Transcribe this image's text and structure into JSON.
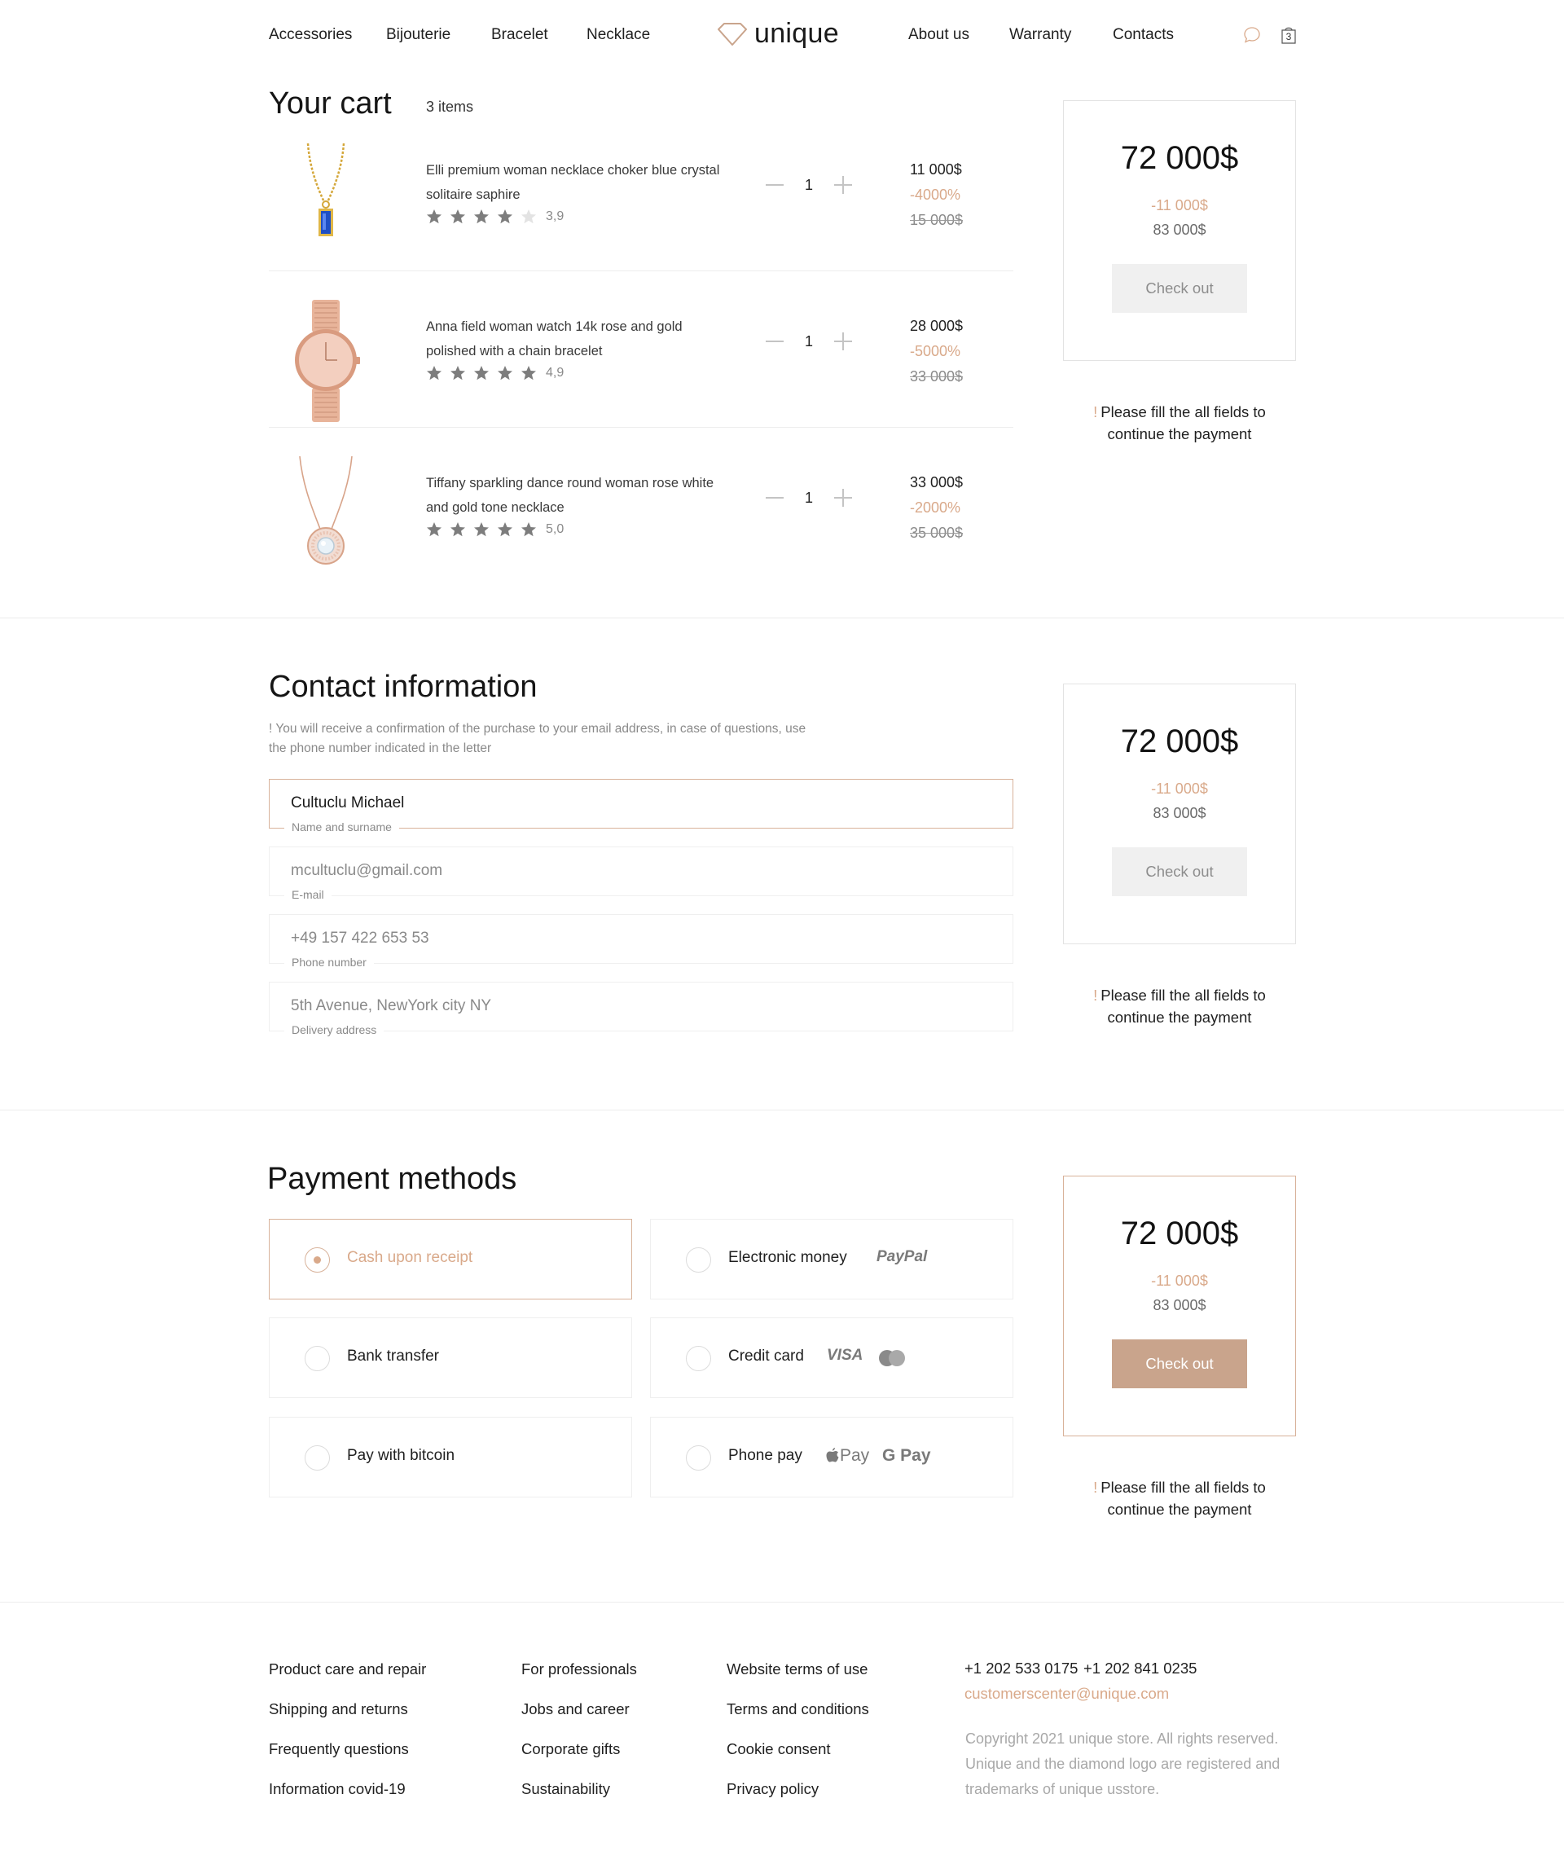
{
  "header": {
    "nav_left": [
      "Accessories",
      "Bijouterie",
      "Bracelet",
      "Necklace"
    ],
    "logo_text": "unique",
    "nav_right": [
      "About us",
      "Warranty",
      "Contacts"
    ],
    "cart_count": "3",
    "icons": [
      "chat-icon",
      "cart-bag-icon"
    ]
  },
  "cart": {
    "title": "Your cart",
    "count_label": "3 items",
    "items": [
      {
        "name": "Elli premium woman necklace choker blue crystal solitaire saphire",
        "rating": "3,9",
        "stars_filled": 4,
        "qty": "1",
        "price": "11 000$",
        "discount": "-4000%",
        "old_price": "15 000$",
        "image": "blue-pendant-necklace"
      },
      {
        "name": "Anna field woman watch 14k rose and gold polished with a chain bracelet",
        "rating": "4,9",
        "stars_filled": 5,
        "qty": "1",
        "price": "28 000$",
        "discount": "-5000%",
        "old_price": "33 000$",
        "image": "rose-gold-watch"
      },
      {
        "name": "Tiffany sparkling dance round woman rose white and gold tone necklace",
        "rating": "5,0",
        "stars_filled": 5,
        "qty": "1",
        "price": "33 000$",
        "discount": "-2000%",
        "old_price": "35 000$",
        "image": "round-diamond-necklace"
      }
    ]
  },
  "summary": {
    "total": "72 000$",
    "discount": "-11 000$",
    "original": "83 000$",
    "checkout_label": "Check out",
    "warning_mark": "!",
    "warning": "Please fill the all fields to continue the payment"
  },
  "contact": {
    "title": "Contact information",
    "note": "! You will receive a confirmation of the purchase to your email address, in case of questions, use the phone number indicated in the letter",
    "fields": [
      {
        "value": "Cultuclu Michael",
        "label": "Name and surname",
        "active": true
      },
      {
        "value": "mcultuclu@gmail.com",
        "label": "E-mail",
        "active": false
      },
      {
        "value": "+49 157 422 653 53",
        "label": "Phone number",
        "active": false
      },
      {
        "value": "5th Avenue, NewYork city NY",
        "label": "Delivery address",
        "active": false
      }
    ]
  },
  "payment": {
    "title": "Payment methods",
    "methods": [
      {
        "label": "Cash upon receipt",
        "selected": true
      },
      {
        "label": "Electronic money",
        "brand": "PayPal",
        "selected": false
      },
      {
        "label": "Bank transfer",
        "selected": false
      },
      {
        "label": "Credit card",
        "brand": "VISA",
        "selected": false
      },
      {
        "label": "Pay with bitcoin",
        "selected": false
      },
      {
        "label": "Phone pay",
        "brand_apple": "Pay",
        "brand_google": "G Pay",
        "selected": false
      }
    ]
  },
  "footer": {
    "col1": [
      "Product care and repair",
      "Shipping and returns",
      "Frequently questions",
      "Information covid-19"
    ],
    "col2": [
      "For professionals",
      "Jobs and career",
      "Corporate gifts",
      "Sustainability"
    ],
    "col3": [
      "Website terms of use",
      "Terms and conditions",
      "Cookie consent",
      "Privacy policy"
    ],
    "phones": [
      "+1 202 533 0175",
      "+1 202 841 0235"
    ],
    "email": "customerscenter@unique.com",
    "copyright": "Copyright 2021 unique store. All rights reserved. Unique and the diamond logo are registered and trademarks of unique usstore."
  },
  "colors": {
    "accent": "#d9a98a",
    "accent_button": "#c9a48c",
    "border_active": "#d8b29a",
    "text": "#1f1f1f",
    "muted": "#8a8a8a"
  }
}
